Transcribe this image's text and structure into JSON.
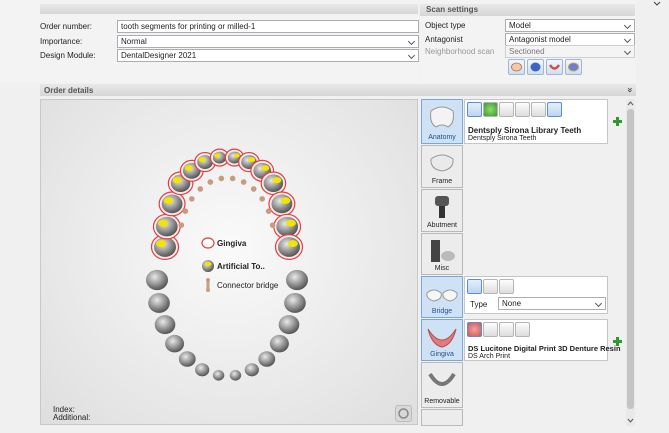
{
  "order": {
    "number_label": "Order number:",
    "number_value": "tooth segments for printing or milled-1",
    "importance_label": "Importance:",
    "importance_value": "Normal",
    "module_label": "Design Module:",
    "module_value": "DentalDesigner 2021"
  },
  "scan": {
    "header": "Scan settings",
    "object_type_label": "Object type",
    "object_type_value": "Model",
    "antagonist_label": "Antagonist",
    "antagonist_value": "Antagonist model",
    "neighborhood_label": "Neighborhood scan",
    "neighborhood_value": "Sectioned",
    "buttons": [
      "scan-jaw-upper-icon",
      "scan-jaw-model-icon",
      "scan-jaw-lower-icon",
      "scan-jaw-antagonist-icon"
    ]
  },
  "details": {
    "header": "Order details",
    "collapse_glyph": "»",
    "index_label": "Index:",
    "additional_label": "Additional:"
  },
  "legend": {
    "gingiva": "Gingiva",
    "artificial": "Artificial To..",
    "connector": "Connector bridge"
  },
  "tabs": {
    "anatomy": "Anatomy",
    "frame": "Frame",
    "abutment": "Abutment",
    "misc": "Misc",
    "bridge": "Bridge",
    "gingiva": "Gingiva",
    "removable": "Removable"
  },
  "anatomy_card": {
    "title": "Dentsply Sirona Library Teeth",
    "subtitle": "Dentsply Sirona Teeth"
  },
  "bridge_card": {
    "type_label": "Type",
    "type_value": "None"
  },
  "gingiva_card": {
    "title": "DS Lucitone Digital Print 3D Denture Resin",
    "subtitle": "DS Arch Print"
  },
  "colors": {
    "accent": "#7aa7d6",
    "gingiva_outline": "#e04040",
    "artificial_marker": "#f2e600",
    "connector": "#c89a7e",
    "add_green": "#2e9a2e"
  }
}
